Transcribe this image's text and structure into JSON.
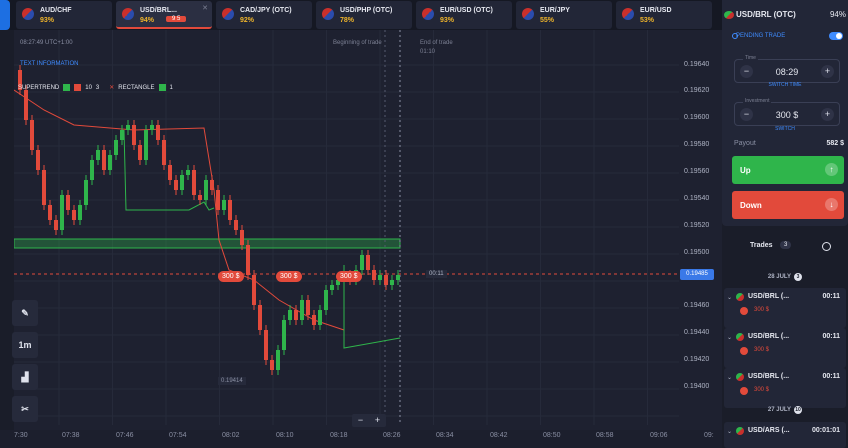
{
  "tabs": [
    {
      "name": "AUD/CHF",
      "pct": "93%"
    },
    {
      "name": "USD/BRL...",
      "pct": "94%",
      "badge": "9 5"
    },
    {
      "name": "CAD/JPY (OTC)",
      "pct": "92%"
    },
    {
      "name": "USD/PHP (OTC)",
      "pct": "78%"
    },
    {
      "name": "EUR/USD (OTC)",
      "pct": "93%"
    },
    {
      "name": "EUR/JPY",
      "pct": "55%"
    },
    {
      "name": "EUR/USD",
      "pct": "53%"
    }
  ],
  "chart": {
    "time_info": "08:27:49 UTC+1:00",
    "link": "TEXT INFORMATION",
    "beginning": "Beginning of trade",
    "end": "End of trade",
    "end_time": "01:10",
    "indicators": {
      "supertrend": "SUPERTREND",
      "st_a": "10",
      "st_b": "3",
      "rectangle": "RECTANGLE",
      "rect_a": "1"
    },
    "price_tag": "0.19485",
    "time_badge": "00:11",
    "low_label": "0.19414",
    "trade_pill": "300 $",
    "y_labels": [
      "0.19640",
      "0.19620",
      "0.19600",
      "0.19580",
      "0.19560",
      "0.19540",
      "0.19520",
      "0.19500",
      "0.19460",
      "0.19440",
      "0.19420",
      "0.19400"
    ],
    "x_labels": [
      "7:30",
      "07:38",
      "07:46",
      "07:54",
      "08:02",
      "08:10",
      "08:18",
      "08:26",
      "08:34",
      "08:42",
      "08:50",
      "08:58",
      "09:06",
      "09:"
    ],
    "tools": {
      "timeframe": "1m"
    }
  },
  "panel": {
    "asset": "USD/BRL (OTC)",
    "asset_pct": "94%",
    "pending": "PENDING TRADE",
    "time_label": "Time",
    "time_value": "08:29",
    "switch_time": "SWITCH TIME",
    "investment_label": "Investment",
    "investment_value": "300 $",
    "switch": "SWITCH",
    "payout_label": "Payout",
    "payout_value": "582 $",
    "up": "Up",
    "down": "Down",
    "trades_title": "Trades",
    "trades_count": "3",
    "date1": "28 JULY",
    "date1_count": "3",
    "trades": [
      {
        "name": "USD/BRL (...",
        "time": "00:11",
        "amount": "300 $"
      },
      {
        "name": "USD/BRL (...",
        "time": "00:11",
        "amount": "300 $"
      },
      {
        "name": "USD/BRL (...",
        "time": "00:11",
        "amount": "300 $"
      }
    ],
    "date2": "27 JULY",
    "date2_count": "10",
    "last_trade": {
      "name": "USD/ARS (...",
      "time": "00:01:01"
    }
  }
}
